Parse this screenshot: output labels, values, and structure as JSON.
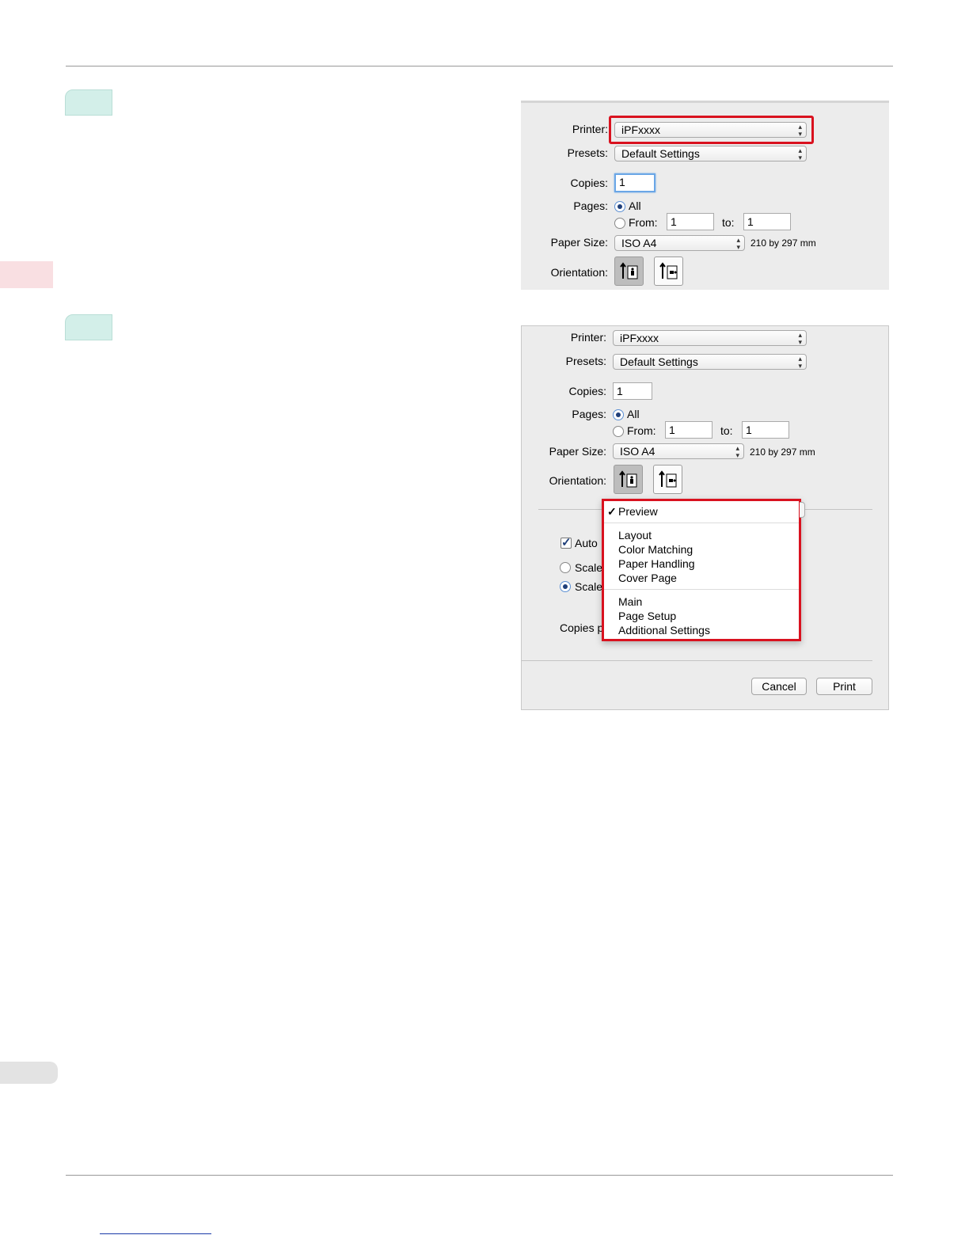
{
  "dialog1": {
    "printer_label": "Printer:",
    "printer_value": "iPFxxxx",
    "presets_label": "Presets:",
    "presets_value": "Default Settings",
    "copies_label": "Copies:",
    "copies_value": "1",
    "pages_label": "Pages:",
    "all_label": "All",
    "from_label": "From:",
    "from_value": "1",
    "to_label": "to:",
    "to_value": "1",
    "paper_label": "Paper Size:",
    "paper_value": "ISO A4",
    "paper_dims": "210 by 297 mm",
    "orientation_label": "Orientation:"
  },
  "dialog2": {
    "printer_label": "Printer:",
    "printer_value": "iPFxxxx",
    "presets_label": "Presets:",
    "presets_value": "Default Settings",
    "copies_label": "Copies:",
    "copies_value": "1",
    "pages_label": "Pages:",
    "all_label": "All",
    "from_label": "From:",
    "from_value": "1",
    "to_label": "to:",
    "to_value": "1",
    "paper_label": "Paper Size:",
    "paper_value": "ISO A4",
    "paper_dims": "210 by 297 mm",
    "orientation_label": "Orientation:",
    "auto_label": "Auto",
    "scale_label_1": "Scale",
    "scale_label_2": "Scale",
    "copies_per_label": "Copies p",
    "menu": {
      "checked_item": "Preview",
      "check_mark": "✓",
      "group1": [
        "Layout",
        "Color Matching",
        "Paper Handling",
        "Cover Page"
      ],
      "group2": [
        "Main",
        "Page Setup",
        "Additional Settings"
      ]
    },
    "cancel_label": "Cancel",
    "print_label": "Print"
  },
  "colors": {
    "highlight_red": "#d9121f",
    "step_badge": "#d3efe9",
    "side_tab": "#f9dfe2"
  }
}
